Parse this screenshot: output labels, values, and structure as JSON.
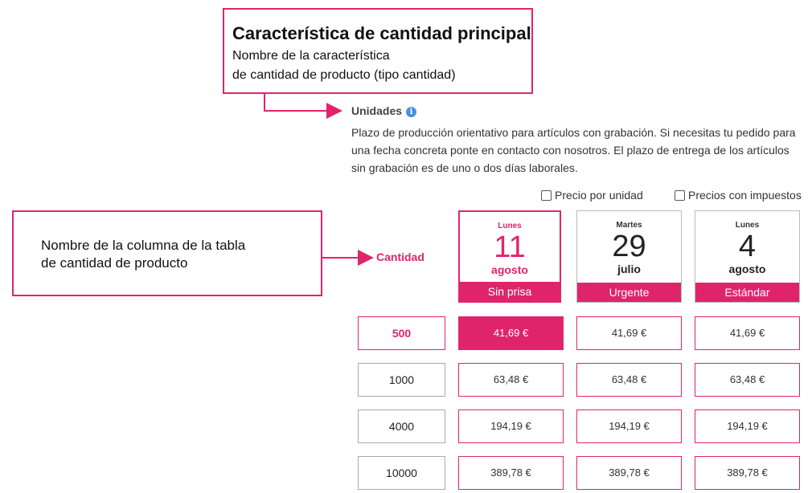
{
  "annotations": {
    "top": {
      "title": "Característica de cantidad principal",
      "line1": "Nombre de la característica",
      "line2": "de cantidad de producto (tipo cantidad)"
    },
    "left": {
      "line1": "Nombre de la columna de la tabla",
      "line2": "de cantidad de producto"
    }
  },
  "section": {
    "heading": "Unidades",
    "info_icon": "i",
    "description": "Plazo de producción orientativo para artículos con grabación. Si necesitas tu pedido para una fecha concreta ponte en contacto con nosotros. El plazo de entrega de los artículos sin grabación es de uno o dos días laborales."
  },
  "options": {
    "unit_price_label": "Precio por unidad",
    "tax_price_label": "Precios con impuestos"
  },
  "table": {
    "qty_header": "Cantidad",
    "columns": [
      {
        "day": "Lunes",
        "date": "11",
        "month": "agosto",
        "label": "Sin prisa"
      },
      {
        "day": "Martes",
        "date": "29",
        "month": "julio",
        "label": "Urgente"
      },
      {
        "day": "Lunes",
        "date": "4",
        "month": "agosto",
        "label": "Estándar"
      }
    ],
    "rows": [
      {
        "qty": "500",
        "prices": [
          "41,69 €",
          "41,69 €",
          "41,69 €"
        ]
      },
      {
        "qty": "1000",
        "prices": [
          "63,48 €",
          "63,48 €",
          "63,48 €"
        ]
      },
      {
        "qty": "4000",
        "prices": [
          "194,19 €",
          "194,19 €",
          "194,19 €"
        ]
      },
      {
        "qty": "10000",
        "prices": [
          "389,78 €",
          "389,78 €",
          "389,78 €"
        ]
      }
    ]
  },
  "colors": {
    "accent": "#e0246c",
    "info": "#4a90e2"
  }
}
